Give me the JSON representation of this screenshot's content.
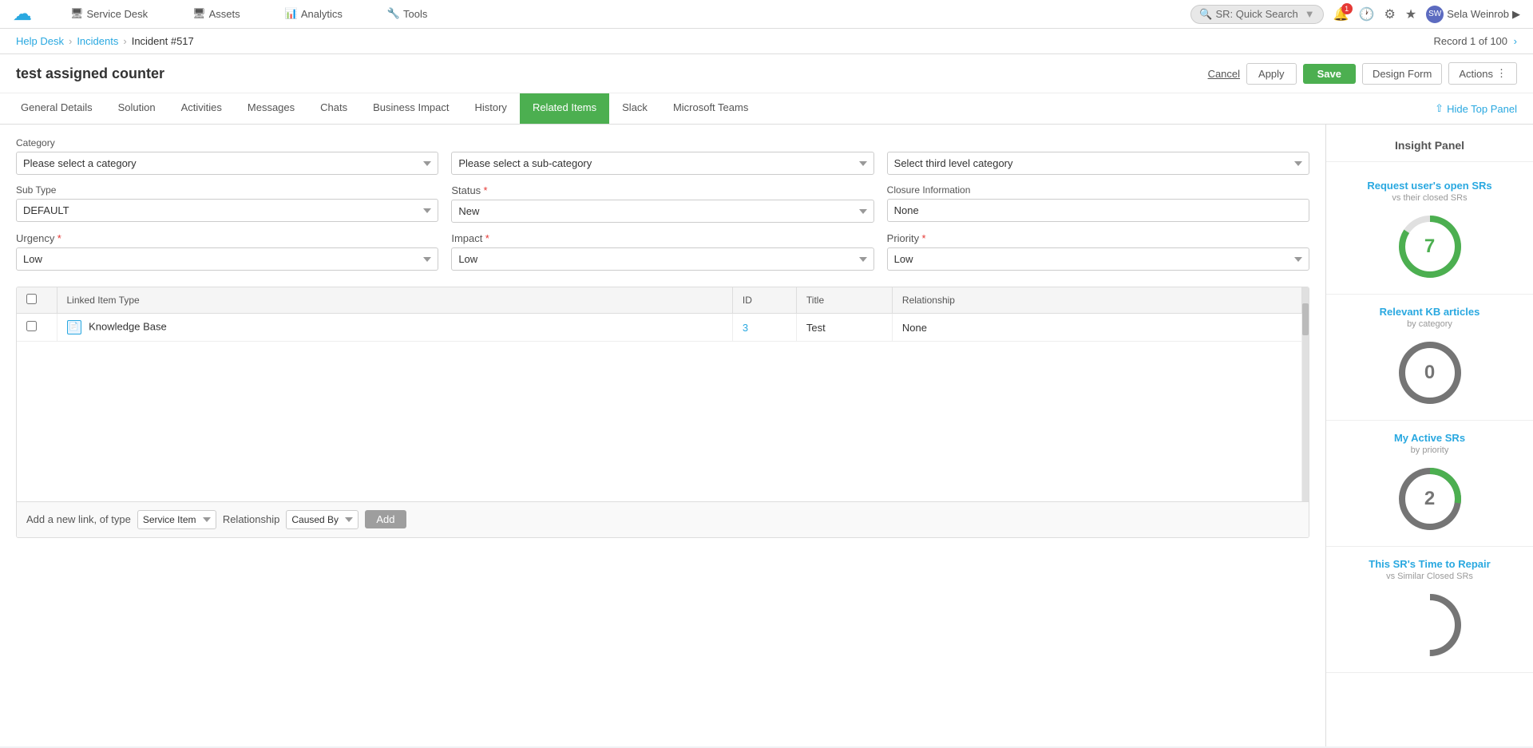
{
  "app": {
    "logo": "☁",
    "nav": [
      {
        "label": "Service Desk",
        "icon": "🖥"
      },
      {
        "label": "Assets",
        "icon": "🖥"
      },
      {
        "label": "Analytics",
        "icon": "📊"
      },
      {
        "label": "Tools",
        "icon": "🔧"
      }
    ],
    "search_placeholder": "SR: Quick Search",
    "user": "Sela Weinrob",
    "notification_count": "1"
  },
  "breadcrumb": {
    "items": [
      "Help Desk",
      "Incidents",
      "Incident #517"
    ]
  },
  "record_nav": "Record 1 of 100",
  "page_title": "test assigned counter",
  "header_buttons": {
    "cancel": "Cancel",
    "apply": "Apply",
    "save": "Save",
    "design_form": "Design Form",
    "actions": "Actions"
  },
  "tabs": [
    {
      "label": "General Details",
      "active": false
    },
    {
      "label": "Solution",
      "active": false
    },
    {
      "label": "Activities",
      "active": false
    },
    {
      "label": "Messages",
      "active": false
    },
    {
      "label": "Chats",
      "active": false
    },
    {
      "label": "Business Impact",
      "active": false
    },
    {
      "label": "History",
      "active": false
    },
    {
      "label": "Related Items",
      "active": true
    },
    {
      "label": "Slack",
      "active": false
    },
    {
      "label": "Microsoft Teams",
      "active": false
    }
  ],
  "hide_panel_btn": "Hide Top Panel",
  "form": {
    "category_label": "Category",
    "category_select": "Please select a category",
    "subcategory_select": "Please select a sub-category",
    "third_level_select": "Select third level category",
    "subtype_label": "Sub Type",
    "subtype_value": "DEFAULT",
    "status_label": "Status",
    "status_required": "*",
    "status_value": "New",
    "closure_label": "Closure Information",
    "closure_value": "None",
    "urgency_label": "Urgency",
    "urgency_required": "*",
    "urgency_value": "Low",
    "impact_label": "Impact",
    "impact_required": "*",
    "impact_value": "Low",
    "priority_label": "Priority",
    "priority_required": "*",
    "priority_value": "Low"
  },
  "table": {
    "columns": [
      "Linked Item Type",
      "ID",
      "Title",
      "Relationship"
    ],
    "rows": [
      {
        "type": "Knowledge Base",
        "id": "3",
        "title": "Test",
        "relationship": "None"
      }
    ]
  },
  "add_link": {
    "label": "Add a new link, of type",
    "type_value": "Service Item",
    "relationship_label": "Relationship",
    "relationship_value": "Caused By",
    "btn_label": "Add"
  },
  "insight_panel": {
    "title": "Insight Panel",
    "cards": [
      {
        "title": "Request user's open SRs",
        "subtitle": "vs their closed SRs",
        "value": 7,
        "color": "green"
      },
      {
        "title": "Relevant KB articles",
        "subtitle": "by category",
        "value": 0,
        "color": "gray"
      },
      {
        "title": "My Active SRs",
        "subtitle": "by priority",
        "value": 2,
        "color": "gray_green"
      },
      {
        "title": "This SR's Time to Repair",
        "subtitle": "vs Similar Closed SRs",
        "value": "",
        "color": "gray"
      }
    ]
  }
}
